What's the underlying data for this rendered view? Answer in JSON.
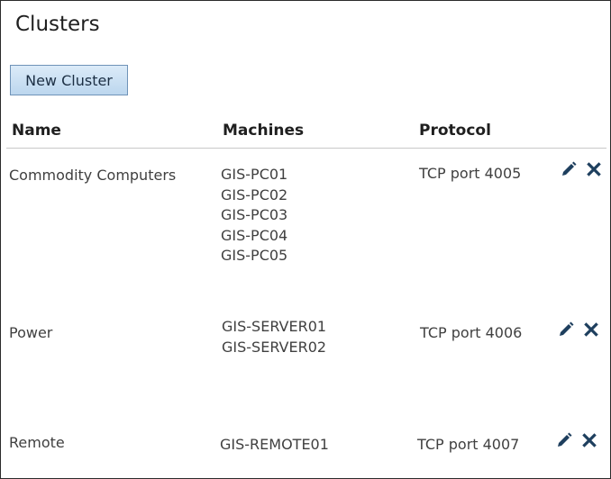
{
  "page": {
    "title": "Clusters"
  },
  "toolbar": {
    "new_cluster_label": "New Cluster"
  },
  "table": {
    "columns": {
      "name": "Name",
      "machines": "Machines",
      "protocol": "Protocol"
    },
    "rows": [
      {
        "name": "Commodity Computers",
        "machines": [
          "GIS-PC01",
          "GIS-PC02",
          "GIS-PC03",
          "GIS-PC04",
          "GIS-PC05"
        ],
        "protocol": "TCP port 4005",
        "actions": [
          "edit",
          "delete"
        ]
      },
      {
        "name": "Power",
        "machines": [
          "GIS-SERVER01",
          "GIS-SERVER02"
        ],
        "protocol": "TCP port 4006",
        "actions": [
          "edit",
          "delete"
        ]
      },
      {
        "name": "Remote",
        "machines": [
          "GIS-REMOTE01"
        ],
        "protocol": "TCP port 4007",
        "actions": [
          "edit",
          "delete"
        ]
      }
    ]
  },
  "icons": {
    "edit": "pencil-icon",
    "delete": "close-icon"
  },
  "colors": {
    "icon": "#1e3f5e",
    "button_fill": "#c9def2",
    "button_border": "#6f93b8"
  }
}
